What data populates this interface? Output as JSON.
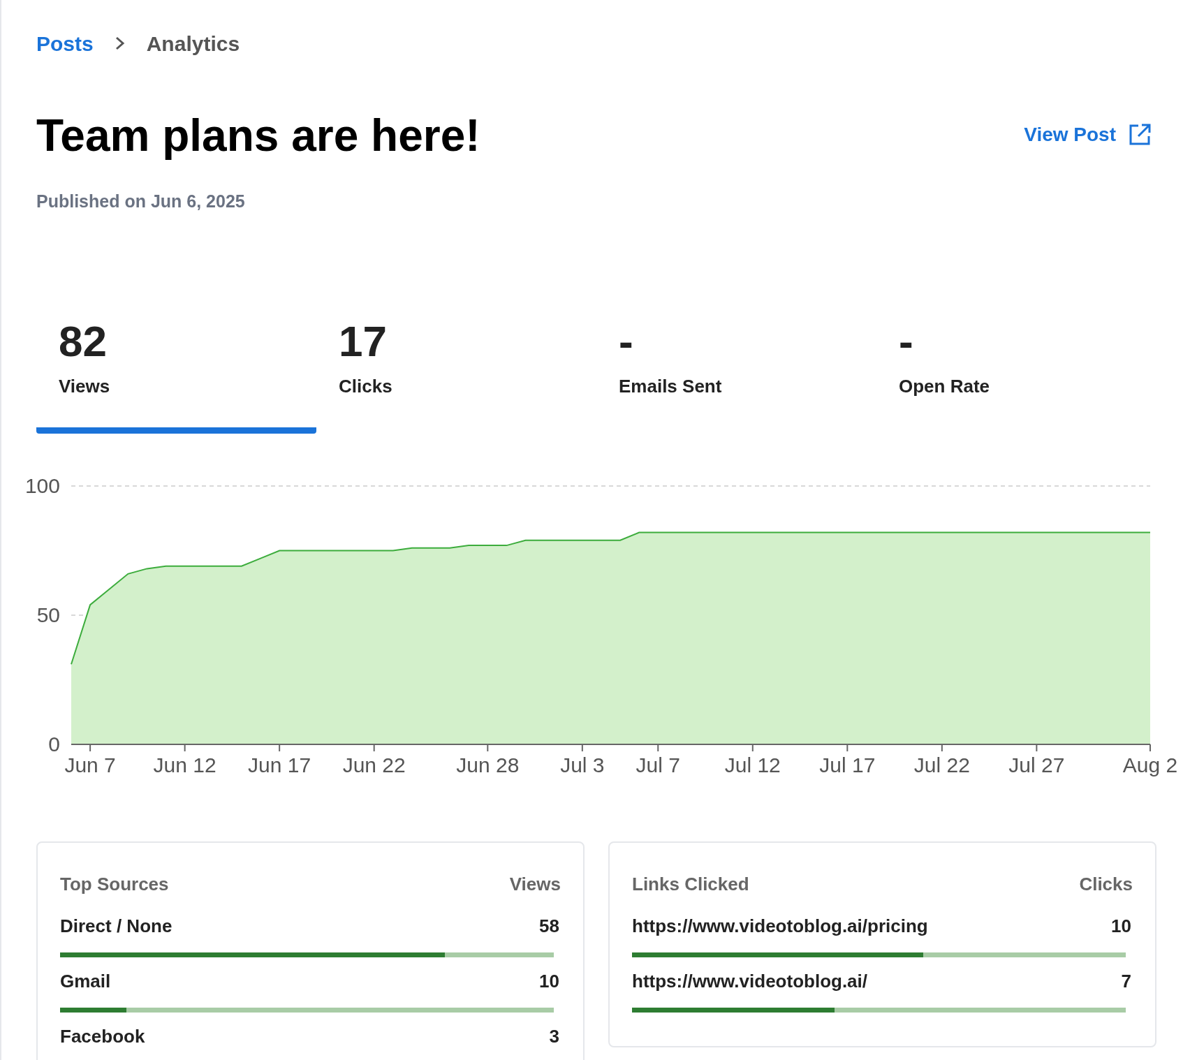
{
  "breadcrumb": [
    {
      "label": "Posts",
      "kind": "link"
    },
    {
      "label": "Analytics",
      "kind": "current"
    }
  ],
  "title": "Team plans are here!",
  "view_post": "View Post",
  "published": "Published on Jun 6, 2025",
  "stats": [
    {
      "value": "82",
      "label": "Views",
      "selected": true
    },
    {
      "value": "17",
      "label": "Clicks",
      "selected": false
    },
    {
      "value": "-",
      "label": "Emails Sent",
      "selected": false
    },
    {
      "value": "-",
      "label": "Open Rate",
      "selected": false
    }
  ],
  "chart_data": {
    "type": "area",
    "categories": [
      null,
      "Jun 7",
      null,
      null,
      null,
      null,
      "Jun 12",
      null,
      null,
      null,
      null,
      "Jun 17",
      null,
      null,
      null,
      null,
      "Jun 22",
      null,
      null,
      null,
      null,
      null,
      "Jun 28",
      null,
      null,
      null,
      null,
      "Jul 3",
      null,
      null,
      null,
      "Jul 7",
      null,
      null,
      null,
      null,
      "Jul 12",
      null,
      null,
      null,
      null,
      "Jul 17",
      null,
      null,
      null,
      null,
      "Jul 22",
      null,
      null,
      null,
      null,
      "Jul 27",
      null,
      null,
      null,
      null,
      null,
      "Aug 2"
    ],
    "series": [
      {
        "color": "#3cac3c",
        "values": [
          31,
          54,
          60,
          66,
          68,
          69,
          69,
          69,
          69,
          69,
          72,
          75,
          75,
          75,
          75,
          75,
          75,
          75,
          76,
          76,
          76,
          77,
          77,
          77,
          79,
          79,
          79,
          79,
          79,
          79,
          82,
          82,
          82,
          82,
          82,
          82,
          82,
          82,
          82,
          82,
          82,
          82,
          82,
          82,
          82,
          82,
          82,
          82,
          82,
          82,
          82,
          82,
          82,
          82,
          82,
          82,
          82,
          82
        ]
      }
    ],
    "ylim": [
      0,
      100
    ],
    "yticks": [
      0,
      50,
      100
    ]
  },
  "top_sources": {
    "title": "Top Sources",
    "column": "Views",
    "rows": [
      {
        "name": "Direct / None",
        "count": "58",
        "level": 0.78
      },
      {
        "name": "Gmail",
        "count": "10",
        "level": 0.134
      },
      {
        "name": "Facebook",
        "count": "3"
      }
    ]
  },
  "links_clicked": {
    "title": "Links Clicked",
    "column": "Clicks",
    "rows": [
      {
        "name": "https://www.videotoblog.ai/pricing",
        "count": "10",
        "level": 0.59
      },
      {
        "name": "https://www.videotoblog.ai/",
        "count": "7",
        "level": 0.41
      }
    ]
  }
}
